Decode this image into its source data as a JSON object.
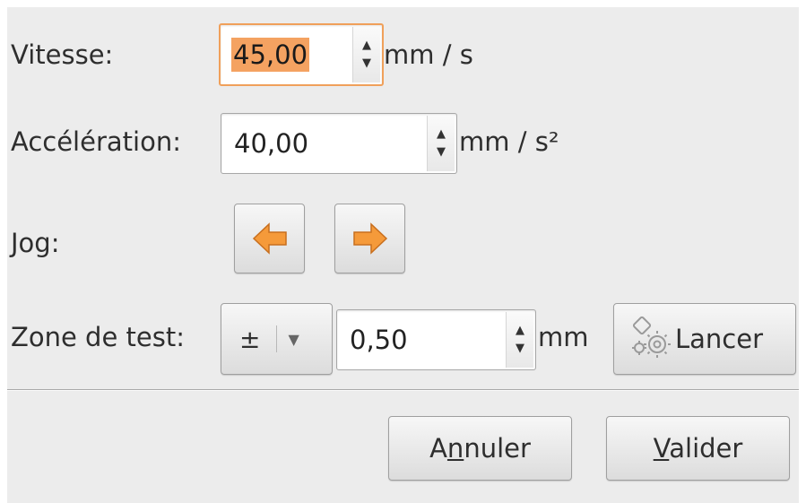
{
  "form": {
    "speed": {
      "label": "Vitesse:",
      "value": "45,00",
      "unit": "mm / s"
    },
    "acceleration": {
      "label": "Accélération:",
      "value": "40,00",
      "unit": "mm / s²"
    },
    "jog": {
      "label": "Jog:"
    },
    "test_zone": {
      "label": "Zone de test:",
      "mode": "±",
      "value": "0,50",
      "unit": "mm",
      "run_label": "Lancer"
    }
  },
  "dialog_buttons": {
    "cancel": {
      "before": "A",
      "mnemonic": "n",
      "after": "nuler"
    },
    "ok": {
      "before": "",
      "mnemonic": "V",
      "after": "alider"
    }
  },
  "icons": [
    "arrow-left-icon",
    "arrow-right-icon",
    "gear-icon",
    "spin-up-icon",
    "spin-down-icon",
    "dropdown-icon"
  ],
  "colors": {
    "focus": "#f0a05a",
    "selection": "#f4a261",
    "arrow_fill": "#f59a3a",
    "panel": "#ececec"
  }
}
